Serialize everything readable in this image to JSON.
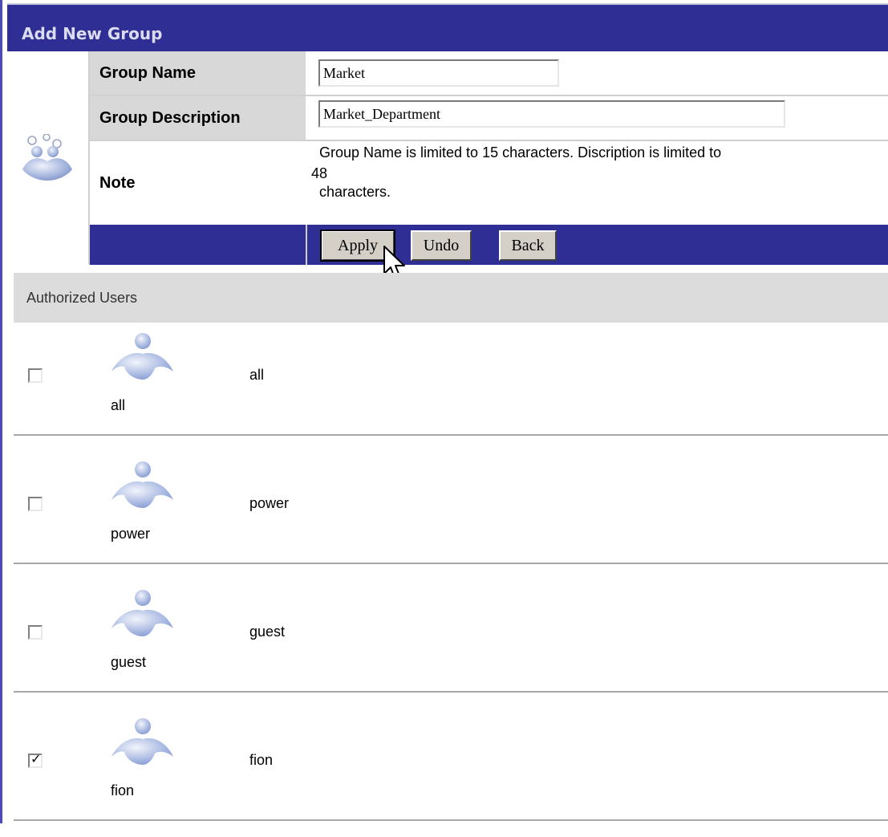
{
  "page": {
    "title": "Add New Group"
  },
  "form": {
    "group_name_label": "Group Name",
    "group_name_value": "Market",
    "group_description_label": "Group Description",
    "group_description_value": "Market_Department",
    "note_label": "Note",
    "note_line1": "Group Name is limited to 15 characters.   Discription is limited to",
    "note_line2": "48",
    "note_line3": "characters."
  },
  "buttons": {
    "apply": "Apply",
    "undo": "Undo",
    "back": "Back"
  },
  "users": {
    "header": "Authorized Users",
    "rows": [
      {
        "icon_caption": "all",
        "name": "all",
        "checked": false
      },
      {
        "icon_caption": "power",
        "name": "power",
        "checked": false
      },
      {
        "icon_caption": "guest",
        "name": "guest",
        "checked": false
      },
      {
        "icon_caption": "fion",
        "name": "fion",
        "checked": true
      }
    ]
  },
  "colors": {
    "header_bg": "#2e2e94",
    "label_bg": "#d8d8d8",
    "icon_blue": "#8ea3d8"
  },
  "icons": {
    "group": "group-users-icon",
    "user": "user-icon",
    "cursor": "mouse-pointer-icon"
  }
}
